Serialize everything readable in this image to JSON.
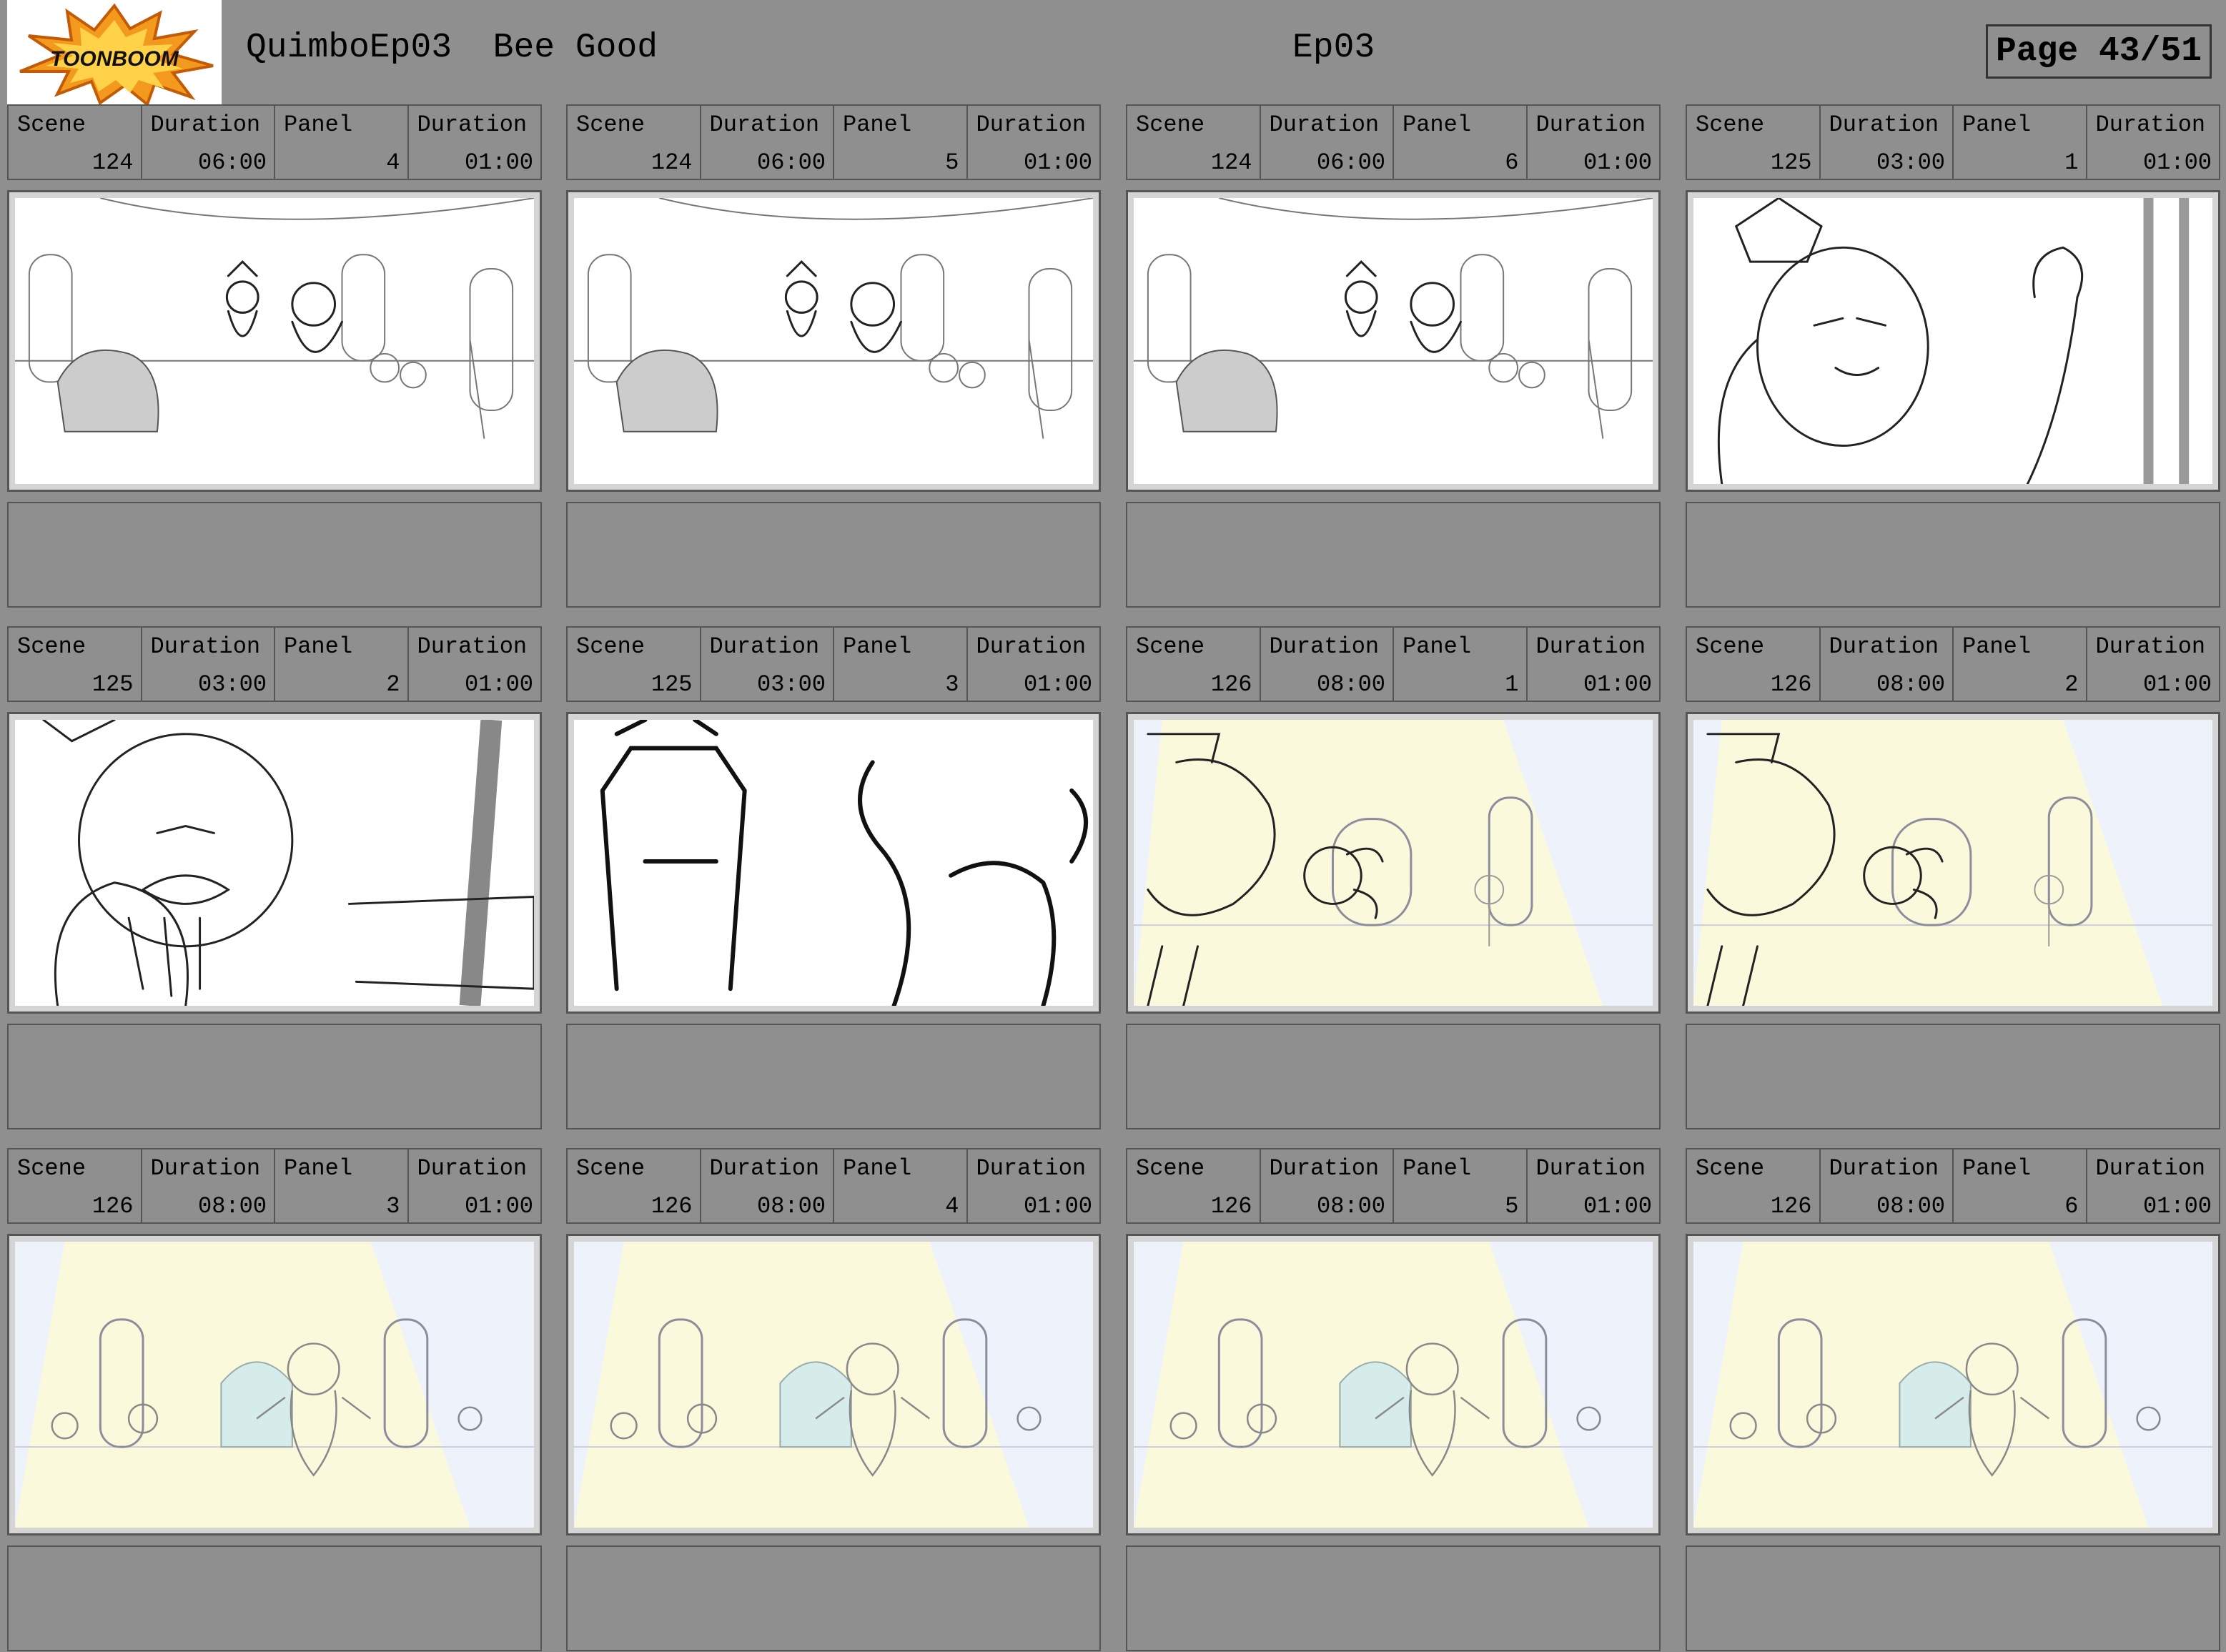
{
  "header": {
    "logo_text": "TOONBOOM",
    "production": "QuimboEp03",
    "episode_title": "Bee Good",
    "episode": "Ep03",
    "page": "Page 43/51"
  },
  "labels": {
    "scene": "Scene",
    "duration": "Duration",
    "panel": "Panel"
  },
  "panels": [
    {
      "scene": "124",
      "scene_duration": "06:00",
      "panel": "4",
      "panel_duration": "01:00",
      "art": "throne-room-wide"
    },
    {
      "scene": "124",
      "scene_duration": "06:00",
      "panel": "5",
      "panel_duration": "01:00",
      "art": "throne-room-wide"
    },
    {
      "scene": "124",
      "scene_duration": "06:00",
      "panel": "6",
      "panel_duration": "01:00",
      "art": "throne-room-wide"
    },
    {
      "scene": "125",
      "scene_duration": "03:00",
      "panel": "1",
      "panel_duration": "01:00",
      "art": "closeup-villain"
    },
    {
      "scene": "125",
      "scene_duration": "03:00",
      "panel": "2",
      "panel_duration": "01:00",
      "art": "closeup-villain-angry"
    },
    {
      "scene": "125",
      "scene_duration": "03:00",
      "panel": "3",
      "panel_duration": "01:00",
      "art": "closeup-crown"
    },
    {
      "scene": "126",
      "scene_duration": "08:00",
      "panel": "1",
      "panel_duration": "01:00",
      "art": "spotlight-fall"
    },
    {
      "scene": "126",
      "scene_duration": "08:00",
      "panel": "2",
      "panel_duration": "01:00",
      "art": "spotlight-fall"
    },
    {
      "scene": "126",
      "scene_duration": "08:00",
      "panel": "3",
      "panel_duration": "01:00",
      "art": "spotlight-wide"
    },
    {
      "scene": "126",
      "scene_duration": "08:00",
      "panel": "4",
      "panel_duration": "01:00",
      "art": "spotlight-wide"
    },
    {
      "scene": "126",
      "scene_duration": "08:00",
      "panel": "5",
      "panel_duration": "01:00",
      "art": "spotlight-wide"
    },
    {
      "scene": "126",
      "scene_duration": "08:00",
      "panel": "6",
      "panel_duration": "01:00",
      "art": "spotlight-wide"
    }
  ]
}
